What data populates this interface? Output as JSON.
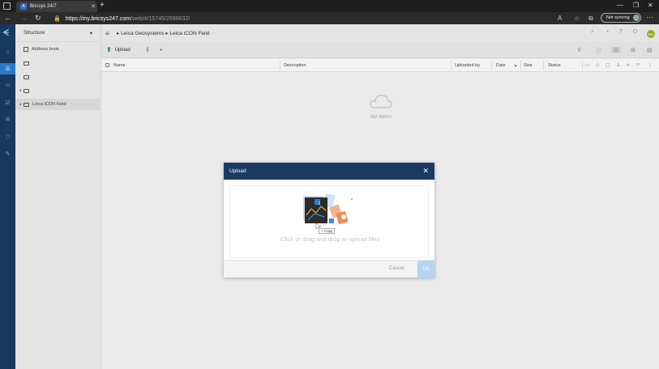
{
  "browser": {
    "tab_title": "Bricsys 24/7",
    "tab_favicon_letter": "A",
    "new_tab": "+",
    "url_host": "https://my.bricsys247.com",
    "url_path": "/web/#/15745/2699632/",
    "sync_label": "Not syncing",
    "more_label": "···"
  },
  "structure": {
    "title": "Structure",
    "caret": "▾",
    "items": [
      {
        "label": "Address book"
      },
      {
        "label": ""
      },
      {
        "label": ""
      },
      {
        "label": ""
      },
      {
        "label": "Leica iCON Field"
      }
    ]
  },
  "main": {
    "breadcrumb": "▸ Leica Geosystems ▸ Leica iCON Field",
    "user_initials": "RH",
    "toolbar": {
      "upload_label": "Upload"
    },
    "columns": {
      "name": "Name",
      "description": "Description",
      "uploaded_by": "Uploaded by",
      "date": "Date",
      "sort_indicator": "▼",
      "size": "Size",
      "status": "Status"
    },
    "empty_label": "No items"
  },
  "modal": {
    "title": "Upload",
    "drop_text": "Click or drag and drop to upload files",
    "copy_badge": "+ Copy",
    "drag_count": "1",
    "cancel_label": "Cancel",
    "ok_label": "OK"
  },
  "colors": {
    "rail": "#1b3b63",
    "modal_header": "#1b3b63",
    "accent": "#2d7fd3",
    "upload_green": "#2e9b4f",
    "ok_disabled": "#b6d3f3"
  }
}
